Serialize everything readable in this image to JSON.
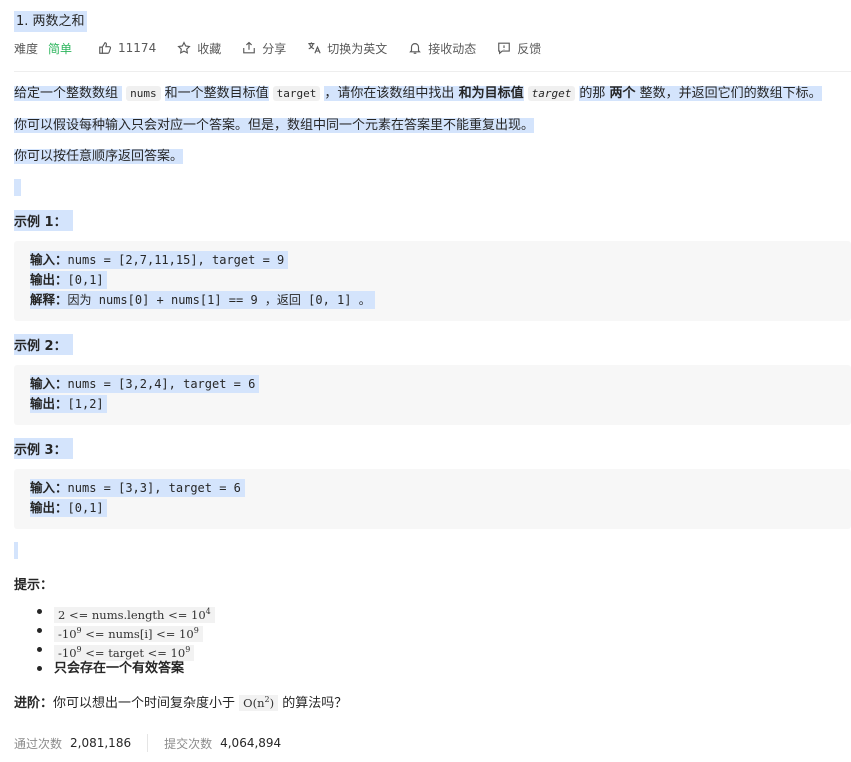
{
  "problem": {
    "title": "1. 两数之和"
  },
  "meta": {
    "difficulty_label": "难度",
    "difficulty_value": "简单",
    "likes": "11174",
    "favorite": "收藏",
    "share": "分享",
    "translate": "切换为英文",
    "subscribe": "接收动态",
    "feedback": "反馈"
  },
  "description": {
    "p1_a": "给定一个整数数组",
    "p1_code1": "nums",
    "p1_b": "和一个整数目标值",
    "p1_code2": "target",
    "p1_c": "，请你在该数组中找出",
    "p1_bold1": "和为目标值",
    "p1_code3": "target",
    "p1_d": "的那",
    "p1_bold2": "两个",
    "p1_e": "整数，并返回它们的数组下标。",
    "p2": "你可以假设每种输入只会对应一个答案。但是，数组中同一个元素在答案里不能重复出现。",
    "p3": "你可以按任意顺序返回答案。"
  },
  "examples": [
    {
      "title": "示例 1：",
      "input_label": "输入：",
      "input": "nums = [2,7,11,15], target = 9",
      "output_label": "输出：",
      "output": "[0,1]",
      "explain_label": "解释：",
      "explain": "因为 nums[0] + nums[1] == 9 ，返回 [0, 1] 。"
    },
    {
      "title": "示例 2：",
      "input_label": "输入：",
      "input": "nums = [3,2,4], target = 6",
      "output_label": "输出：",
      "output": "[1,2]"
    },
    {
      "title": "示例 3：",
      "input_label": "输入：",
      "input": "nums = [3,3], target = 6",
      "output_label": "输出：",
      "output": "[0,1]"
    }
  ],
  "hints": {
    "title": "提示：",
    "c1_text": "2 <= nums.length <= 10",
    "c1_sup": "4",
    "c2_pre": "-10",
    "c2_pre_sup": "9",
    "c2_mid": " <= nums[i] <= 10",
    "c2_sup": "9",
    "c3_pre": "-10",
    "c3_pre_sup": "9",
    "c3_mid": " <= target <= 10",
    "c3_sup": "9",
    "c4": "只会存在一个有效答案"
  },
  "advanced": {
    "label": "进阶：",
    "text_a": "你可以想出一个时间复杂度小于",
    "code": "O(n",
    "code_sup": "2",
    "code_end": ")",
    "text_b": "的算法吗？"
  },
  "stats": {
    "accepted_label": "通过次数",
    "accepted": "2,081,186",
    "submissions_label": "提交次数",
    "submissions": "4,064,894"
  },
  "icons": {
    "like": "thumbs-up-icon",
    "favorite": "star-icon",
    "share": "share-icon",
    "translate": "translate-icon",
    "subscribe": "bell-icon",
    "feedback": "feedback-icon"
  },
  "colors": {
    "easy": "#2db55d",
    "highlight": "#d4e4fc"
  }
}
